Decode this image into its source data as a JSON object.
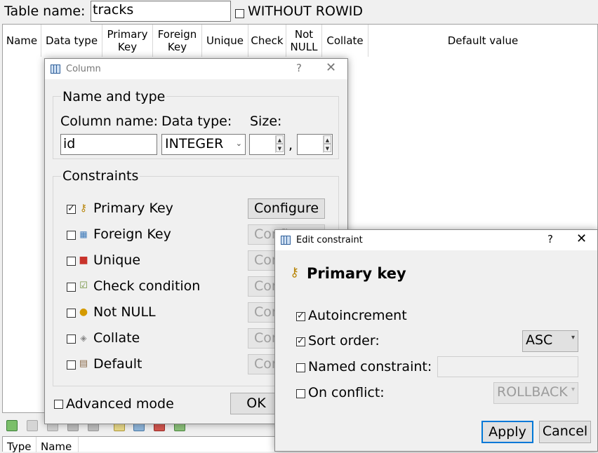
{
  "table": {
    "name_label": "Table name:",
    "name_value": "tracks",
    "without_rowid_label": "WITHOUT ROWID",
    "without_rowid_checked": false,
    "columns": [
      "Name",
      "Data type",
      "Primary\nKey",
      "Foreign\nKey",
      "Unique",
      "Check",
      "Not\nNULL",
      "Collate",
      "Default value"
    ]
  },
  "bottom_table": {
    "columns": [
      "Type",
      "Name"
    ]
  },
  "column_dialog": {
    "title": "Column",
    "help": "?",
    "close": "✕",
    "name_type_group": "Name and type",
    "column_name_label": "Column name:",
    "data_type_label": "Data type:",
    "size_label": "Size:",
    "column_name_value": "id",
    "data_type_value": "INTEGER",
    "size_separator": ",",
    "constraints_group": "Constraints",
    "constraints": [
      {
        "label": "Primary Key",
        "checked": true,
        "icon": "key-icon",
        "button": "Configure"
      },
      {
        "label": "Foreign Key",
        "checked": false,
        "icon": "foreign-key-icon",
        "button": "Configure"
      },
      {
        "label": "Unique",
        "checked": false,
        "icon": "unique-icon",
        "button": "Configure"
      },
      {
        "label": "Check condition",
        "checked": false,
        "icon": "check-condition-icon",
        "button": "Configure"
      },
      {
        "label": "Not NULL",
        "checked": false,
        "icon": "not-null-icon",
        "button": "Configure"
      },
      {
        "label": "Collate",
        "checked": false,
        "icon": "collate-icon",
        "button": "Configure"
      },
      {
        "label": "Default",
        "checked": false,
        "icon": "default-icon",
        "button": "Configure"
      }
    ],
    "advanced_mode_label": "Advanced mode",
    "ok_label": "OK"
  },
  "edit_constraint": {
    "title": "Edit constraint",
    "help": "?",
    "close": "✕",
    "heading": "Primary key",
    "autoincrement_label": "Autoincrement",
    "autoincrement_checked": true,
    "sort_order_label": "Sort order:",
    "sort_order_checked": true,
    "sort_order_value": "ASC",
    "named_constraint_label": "Named constraint:",
    "named_constraint_checked": false,
    "on_conflict_label": "On conflict:",
    "on_conflict_checked": false,
    "on_conflict_value": "ROLLBACK",
    "apply_label": "Apply",
    "cancel_label": "Cancel"
  }
}
